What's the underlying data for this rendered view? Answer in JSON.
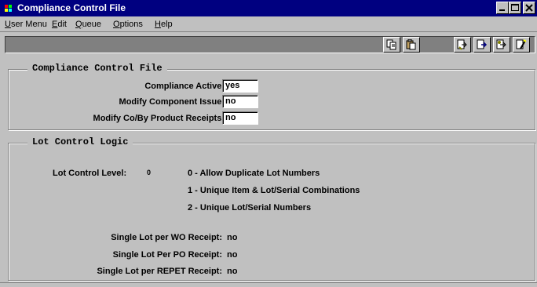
{
  "window": {
    "title": "Compliance Control File",
    "title_color": "#000080",
    "controls": [
      "minimize-icon",
      "maximize-icon",
      "close-icon"
    ]
  },
  "menu": {
    "items": [
      {
        "label": "User Menu",
        "mnemonic": "U"
      },
      {
        "label": "Edit",
        "mnemonic": "E"
      },
      {
        "label": "Queue",
        "mnemonic": "Q"
      },
      {
        "label": "Options",
        "mnemonic": "O"
      },
      {
        "label": "Help",
        "mnemonic": "H"
      }
    ]
  },
  "toolbar": {
    "buttons": [
      "copy-icon",
      "paste-icon",
      "next-record-icon",
      "previous-record-icon",
      "find-record-icon",
      "insert-record-icon"
    ]
  },
  "compliance": {
    "section_title": "Compliance Control File",
    "fields": [
      {
        "label": "Compliance Active:",
        "value": "yes"
      },
      {
        "label": "Modify Component Issue:",
        "value": "no"
      },
      {
        "label": "Modify Co/By Product Receipts:",
        "value": "no"
      }
    ]
  },
  "lot_control": {
    "section_title": "Lot Control Logic",
    "level_label": "Lot Control Level:",
    "level_value": "0",
    "options": [
      "0 - Allow Duplicate Lot Numbers",
      "1 - Unique Item & Lot/Serial Combinations",
      "2 - Unique Lot/Serial Numbers"
    ],
    "receipts": [
      {
        "label": "Single Lot per WO Receipt:",
        "value": "no"
      },
      {
        "label": "Single Lot Per PO Receipt:",
        "value": "no"
      },
      {
        "label": "Single Lot per REPET Receipt:",
        "value": "no"
      }
    ]
  }
}
